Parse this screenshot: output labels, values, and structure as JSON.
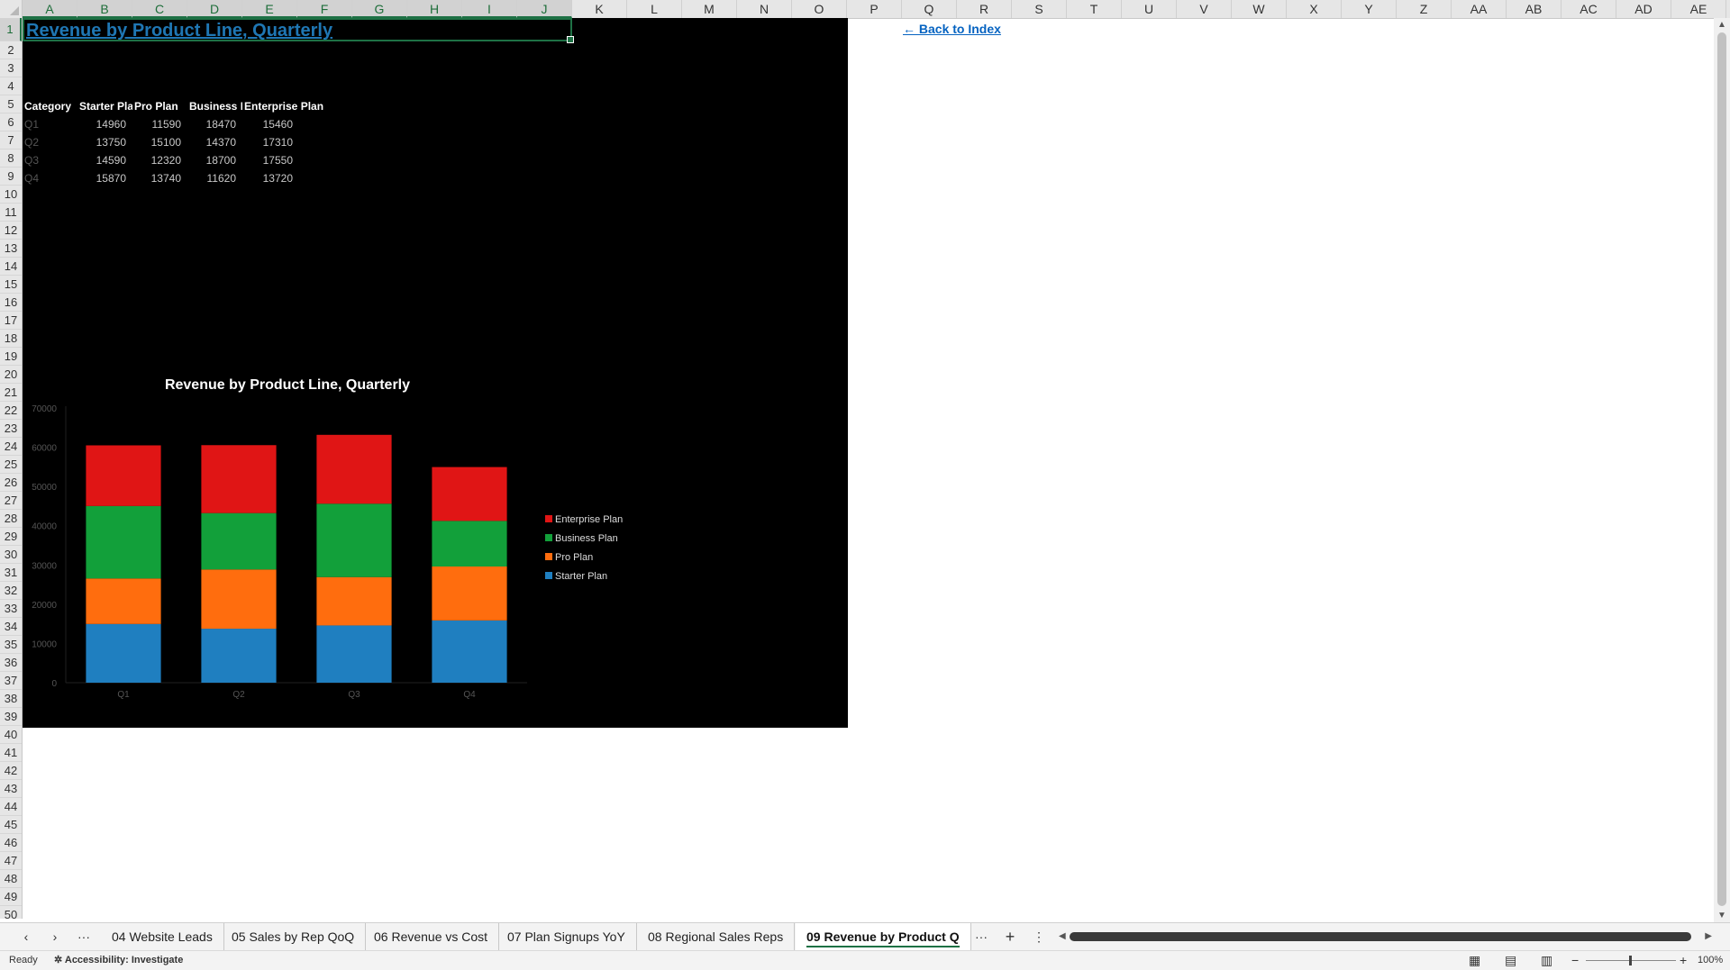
{
  "columns": [
    "A",
    "B",
    "C",
    "D",
    "E",
    "F",
    "G",
    "H",
    "I",
    "J",
    "K",
    "L",
    "M",
    "N",
    "O",
    "P",
    "Q",
    "R",
    "S",
    "T",
    "U",
    "V",
    "W",
    "X",
    "Y",
    "Z",
    "AA",
    "AB",
    "AC",
    "AD",
    "AE"
  ],
  "rows": [
    "1",
    "2",
    "3",
    "4",
    "5",
    "6",
    "7",
    "8",
    "9",
    "10",
    "11",
    "12",
    "13",
    "14",
    "15",
    "16",
    "17",
    "18",
    "19",
    "20",
    "21",
    "22",
    "23",
    "24",
    "25",
    "26",
    "27",
    "28",
    "29",
    "30",
    "31",
    "32",
    "33",
    "34",
    "35",
    "36",
    "37",
    "38",
    "39",
    "40",
    "41",
    "42",
    "43",
    "44",
    "45",
    "46",
    "47",
    "48",
    "49",
    "50"
  ],
  "sheet": {
    "title": "Revenue by Product Line, Quarterly",
    "back_link": "← Back to Index",
    "table": {
      "headers": [
        "Category",
        "Starter Plan",
        "Pro Plan",
        "Business Plan",
        "Enterprise Plan"
      ],
      "rows": [
        {
          "cat": "Q1",
          "v": [
            "14960",
            "11590",
            "18470",
            "15460"
          ]
        },
        {
          "cat": "Q2",
          "v": [
            "13750",
            "15100",
            "14370",
            "17310"
          ]
        },
        {
          "cat": "Q3",
          "v": [
            "14590",
            "12320",
            "18700",
            "17550"
          ]
        },
        {
          "cat": "Q4",
          "v": [
            "15870",
            "13740",
            "11620",
            "13720"
          ]
        }
      ]
    }
  },
  "chart_data": {
    "type": "bar",
    "stacked": true,
    "title": "Revenue by Product Line, Quarterly",
    "categories": [
      "Q1",
      "Q2",
      "Q3",
      "Q4"
    ],
    "series": [
      {
        "name": "Starter Plan",
        "color": "#1f7fc0",
        "values": [
          14960,
          13750,
          14590,
          15870
        ]
      },
      {
        "name": "Pro Plan",
        "color": "#ff6d0e",
        "values": [
          11590,
          15100,
          12320,
          13740
        ]
      },
      {
        "name": "Business Plan",
        "color": "#12a03a",
        "values": [
          18470,
          14370,
          18700,
          11620
        ]
      },
      {
        "name": "Enterprise Plan",
        "color": "#e01515",
        "values": [
          15460,
          17310,
          17550,
          13720
        ]
      }
    ],
    "yticks": [
      "0",
      "10000",
      "20000",
      "30000",
      "40000",
      "50000",
      "60000",
      "70000"
    ],
    "ylim": [
      0,
      70000
    ],
    "legend_position": "right",
    "legend_order": [
      "Enterprise Plan",
      "Business Plan",
      "Pro Plan",
      "Starter Plan"
    ],
    "grid": false
  },
  "tabs": {
    "items": [
      "04 Website Leads",
      "05 Sales by Rep QoQ",
      "06 Revenue vs Cost",
      "07 Plan Signups YoY",
      "08 Regional Sales Reps",
      "09 Revenue by Product Q"
    ],
    "active": "09 Revenue by Product Q",
    "more": "···",
    "add": "+",
    "options": "⋮"
  },
  "status": {
    "ready": "Ready",
    "accessibility": "Accessibility: Investigate",
    "zoom": "100%"
  }
}
